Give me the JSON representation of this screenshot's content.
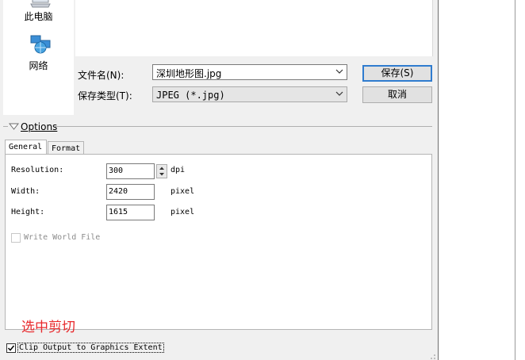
{
  "nav": {
    "this_pc": "此电脑",
    "network": "网络"
  },
  "save_form": {
    "filename_label": "文件名(N):",
    "filename_value": "深圳地形图.jpg",
    "filetype_label": "保存类型(T):",
    "filetype_value": "JPEG (*.jpg)",
    "save_button": "保存(S)",
    "cancel_button": "取消"
  },
  "options": {
    "header": "Options",
    "tabs": [
      "General",
      "Format"
    ],
    "resolution_label": "Resolution:",
    "resolution_value": "300",
    "resolution_unit": "dpi",
    "width_label": "Width:",
    "width_value": "2420",
    "width_unit": "pixel",
    "height_label": "Height:",
    "height_value": "1615",
    "height_unit": "pixel",
    "world_file_label": "Write World File",
    "clip_label": "Clip Output to Graphics Extent",
    "clip_checked": true
  },
  "annotation": "选中剪切",
  "colors": {
    "annotation_red": "#e8282b",
    "default_button_border": "#2f7ccf"
  }
}
